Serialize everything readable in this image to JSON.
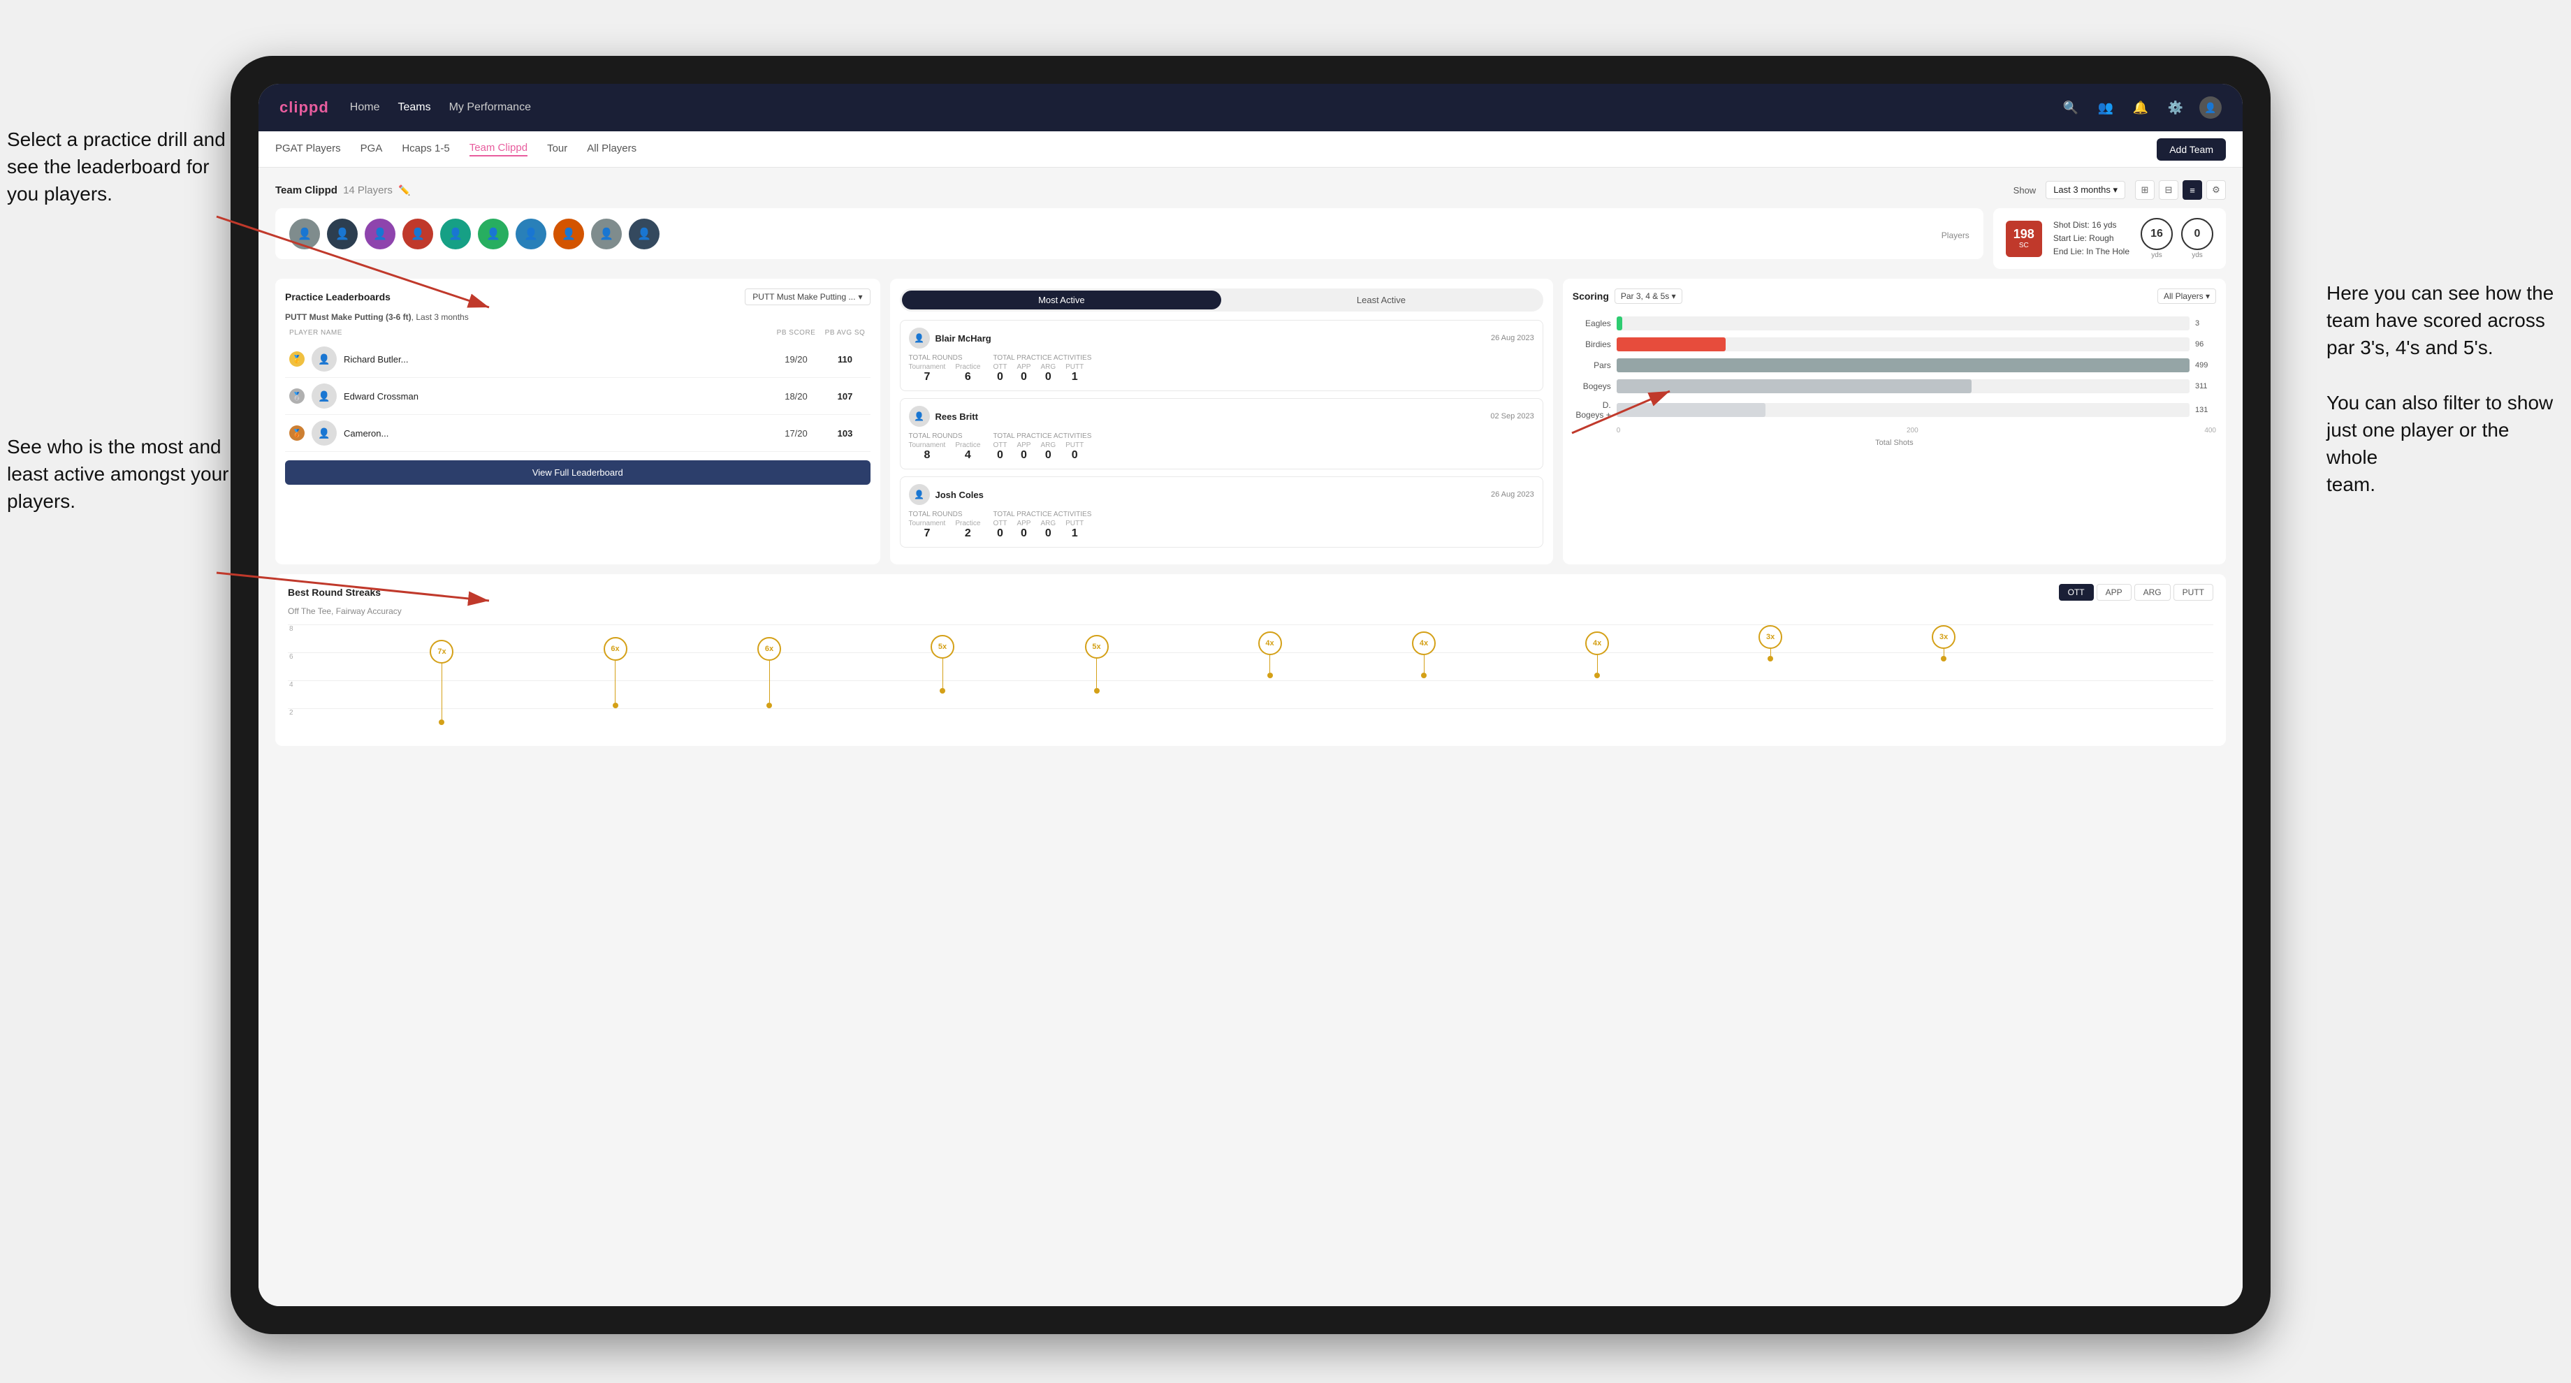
{
  "annotations": {
    "top_left": "Select a practice drill and see the leaderboard for you players.",
    "bottom_left": "See who is the most and least active amongst your players.",
    "right": "Here you can see how the team have scored across par 3's, 4's and 5's.\n\nYou can also filter to show just one player or the whole team."
  },
  "nav": {
    "logo": "clippd",
    "items": [
      "Home",
      "Teams",
      "My Performance"
    ],
    "icons": [
      "search",
      "people",
      "bell",
      "settings",
      "profile"
    ],
    "active": "Teams"
  },
  "subnav": {
    "items": [
      "PGAT Players",
      "PGA",
      "Hcaps 1-5",
      "Team Clippd",
      "Tour",
      "All Players"
    ],
    "active": "Team Clippd",
    "add_team_label": "Add Team"
  },
  "team": {
    "title": "Team Clippd",
    "player_count": "14 Players",
    "show_label": "Show",
    "show_value": "Last 3 months",
    "view_modes": [
      "grid-2",
      "grid-3",
      "list",
      "settings"
    ],
    "active_view": 2
  },
  "shot_card": {
    "badge_value": "198",
    "badge_sub": "SC",
    "info_lines": [
      "Shot Dist: 16 yds",
      "Start Lie: Rough",
      "End Lie: In The Hole"
    ],
    "circle1_val": "16",
    "circle1_label": "yds",
    "circle2_val": "0",
    "circle2_label": "yds"
  },
  "practice_leaderboard": {
    "title": "Practice Leaderboards",
    "dropdown": "PUTT Must Make Putting ...",
    "drill_name": "PUTT Must Make Putting (3-6 ft)",
    "time_period": "Last 3 months",
    "columns": [
      "PLAYER NAME",
      "PB SCORE",
      "PB AVG SQ"
    ],
    "players": [
      {
        "rank": 1,
        "rank_class": "gold",
        "name": "Richard Butler...",
        "score": "19/20",
        "avg": "110"
      },
      {
        "rank": 2,
        "rank_class": "silver",
        "name": "Edward Crossman",
        "score": "18/20",
        "avg": "107"
      },
      {
        "rank": 3,
        "rank_class": "bronze",
        "name": "Cameron...",
        "score": "17/20",
        "avg": "103"
      }
    ],
    "view_full_label": "View Full Leaderboard"
  },
  "activity": {
    "tabs": [
      "Most Active",
      "Least Active"
    ],
    "active_tab": 0,
    "players": [
      {
        "name": "Blair McHarg",
        "date": "26 Aug 2023",
        "total_rounds_label": "Total Rounds",
        "tournament_val": "7",
        "practice_val": "6",
        "total_practice_label": "Total Practice Activities",
        "ott": "0",
        "app": "0",
        "arg": "0",
        "putt": "1"
      },
      {
        "name": "Rees Britt",
        "date": "02 Sep 2023",
        "total_rounds_label": "Total Rounds",
        "tournament_val": "8",
        "practice_val": "4",
        "total_practice_label": "Total Practice Activities",
        "ott": "0",
        "app": "0",
        "arg": "0",
        "putt": "0"
      },
      {
        "name": "Josh Coles",
        "date": "26 Aug 2023",
        "total_rounds_label": "Total Rounds",
        "tournament_val": "7",
        "practice_val": "2",
        "total_practice_label": "Total Practice Activities",
        "ott": "0",
        "app": "0",
        "arg": "0",
        "putt": "1"
      }
    ]
  },
  "scoring": {
    "title": "Scoring",
    "filter1": "Par 3, 4 & 5s",
    "filter2": "All Players",
    "bars": [
      {
        "label": "Eagles",
        "value": 3,
        "max": 499,
        "class": "eagles"
      },
      {
        "label": "Birdies",
        "value": 96,
        "max": 499,
        "class": "birdies"
      },
      {
        "label": "Pars",
        "value": 499,
        "max": 499,
        "class": "pars"
      },
      {
        "label": "Bogeys",
        "value": 311,
        "max": 499,
        "class": "bogeys"
      },
      {
        "label": "D. Bogeys +",
        "value": 131,
        "max": 499,
        "class": "dbogeys"
      }
    ],
    "axis_labels": [
      "0",
      "200",
      "400"
    ],
    "total_shots_label": "Total Shots"
  },
  "streaks": {
    "title": "Best Round Streaks",
    "tabs": [
      "OTT",
      "APP",
      "ARG",
      "PUTT"
    ],
    "active_tab": "OTT",
    "subtitle": "Off The Tee, Fairway Accuracy",
    "points": [
      {
        "x_pct": 8,
        "y_pct": 20,
        "label": "7x"
      },
      {
        "x_pct": 17,
        "y_pct": 35,
        "label": "6x"
      },
      {
        "x_pct": 24,
        "y_pct": 35,
        "label": "6x"
      },
      {
        "x_pct": 33,
        "y_pct": 50,
        "label": "5x"
      },
      {
        "x_pct": 41,
        "y_pct": 50,
        "label": "5x"
      },
      {
        "x_pct": 51,
        "y_pct": 65,
        "label": "4x"
      },
      {
        "x_pct": 59,
        "y_pct": 65,
        "label": "4x"
      },
      {
        "x_pct": 67,
        "y_pct": 65,
        "label": "4x"
      },
      {
        "x_pct": 76,
        "y_pct": 80,
        "label": "3x"
      },
      {
        "x_pct": 85,
        "y_pct": 80,
        "label": "3x"
      }
    ]
  },
  "player_colors": [
    "#7f8c8d",
    "#2c3e50",
    "#8e44ad",
    "#c0392b",
    "#16a085",
    "#27ae60",
    "#2980b9",
    "#d35400",
    "#7f8c8d",
    "#34495e"
  ]
}
